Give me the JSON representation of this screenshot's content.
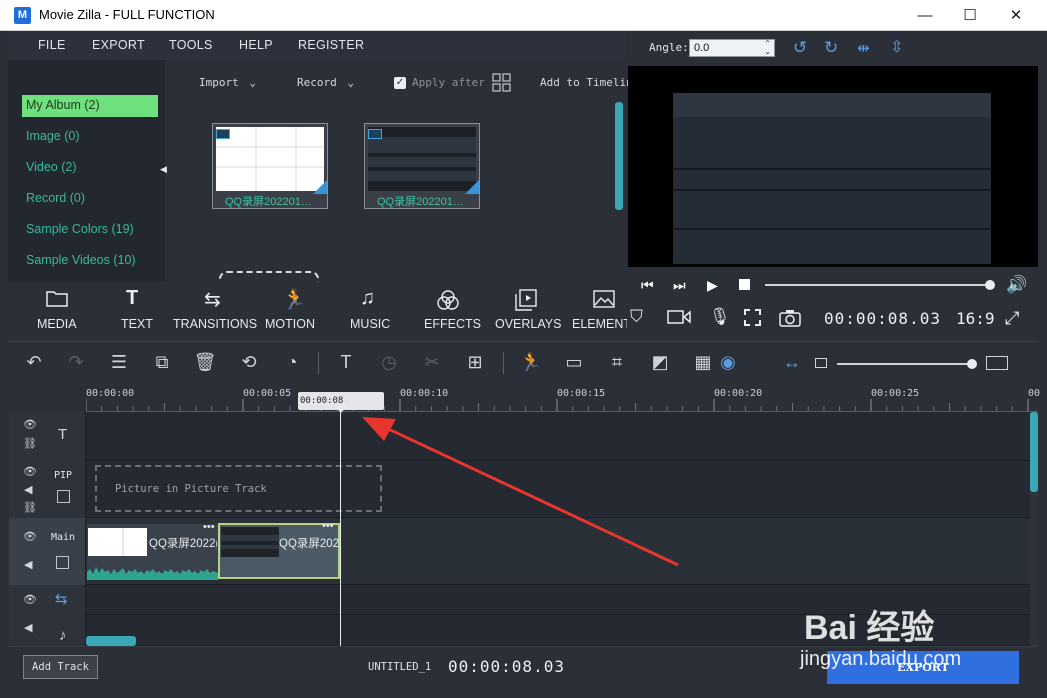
{
  "window": {
    "title": "Movie Zilla - FULL FUNCTION",
    "logo_letter": "M",
    "minimize": "—",
    "maximize": "☐",
    "close": "✕"
  },
  "menu": [
    "FILE",
    "EXPORT",
    "TOOLS",
    "HELP",
    "REGISTER"
  ],
  "album": {
    "items": [
      {
        "label": "My Album (2)",
        "active": true
      },
      {
        "label": "Image (0)"
      },
      {
        "label": "Video (2)"
      },
      {
        "label": "Record (0)"
      },
      {
        "label": "Sample Colors (19)"
      },
      {
        "label": "Sample Videos (10)"
      }
    ]
  },
  "media_toolbar": {
    "import": "Import",
    "record": "Record",
    "apply_after": "Apply after",
    "apply_after_checked": true,
    "add_to_timeline": "Add to Timelin"
  },
  "media_items": [
    {
      "label": "QQ录屏202201…"
    },
    {
      "label": "QQ录屏202201…"
    }
  ],
  "preview": {
    "angle_label": "Angle:",
    "angle_value": "0.0",
    "timecode": "00:00:08.03",
    "aspect": "16:9",
    "progress": 1.0
  },
  "categories": [
    "MEDIA",
    "TEXT",
    "TRANSITIONS",
    "MOTION",
    "MUSIC",
    "EFFECTS",
    "OVERLAYS",
    "ELEMENTS"
  ],
  "ruler": {
    "labels": [
      "00:00:00",
      "00:00:05",
      "00:00:10",
      "00:00:15",
      "00:00:20",
      "00:00:25",
      "00"
    ],
    "playhead_time": "00:00:08"
  },
  "tracks": {
    "pip_name": "PIP",
    "pip_placeholder": "Picture in Picture Track",
    "main_name": "Main",
    "clips": [
      {
        "label": "QQ录屏2022("
      },
      {
        "label": "QQ录屏202:"
      }
    ]
  },
  "status": {
    "add_track": "Add Track",
    "project_name": "UNTITLED_1",
    "timecode": "00:00:08.03",
    "export": "EXPORT"
  },
  "watermark": {
    "text": "Bai 经验",
    "url": "jingyan.baidu.com"
  },
  "colors": {
    "accent_green": "#6fe07e",
    "teal_text": "#39b89c",
    "annotation_arrow": "#e8352e",
    "export_blue": "#2f6fe0"
  }
}
